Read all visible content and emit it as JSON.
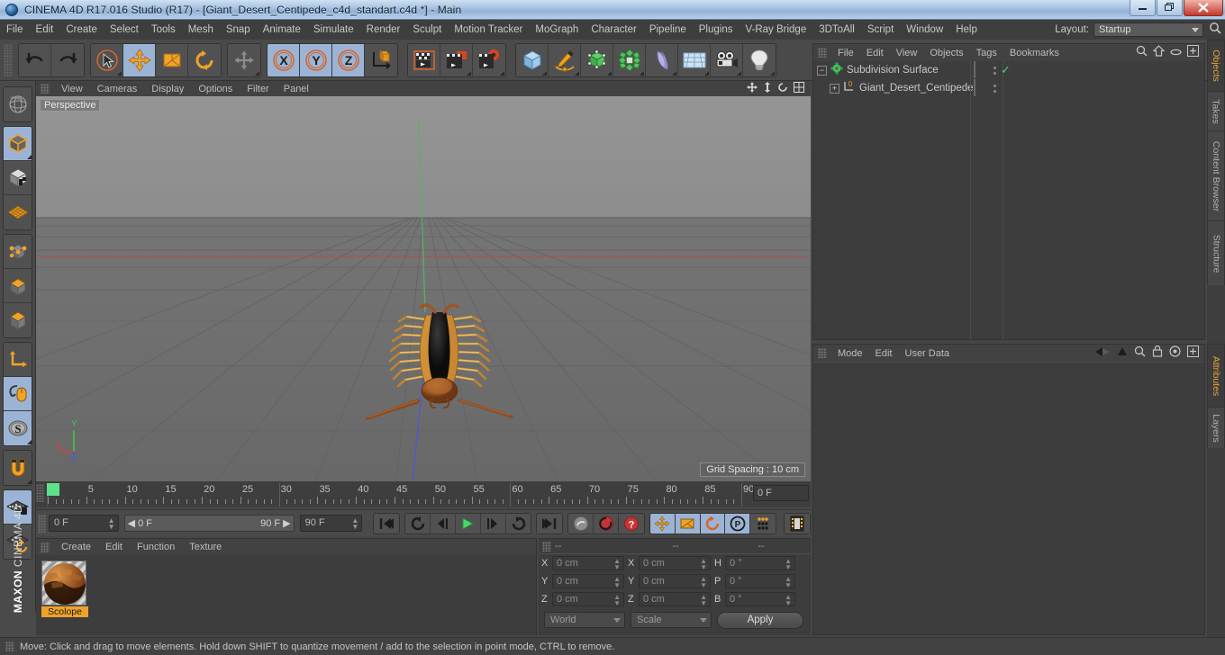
{
  "window": {
    "title": "CINEMA 4D R17.016 Studio (R17) - [Giant_Desert_Centipede_c4d_standart.c4d *] - Main",
    "minimize": "—",
    "restore": "❐",
    "close": "✕"
  },
  "menubar": {
    "items": [
      "File",
      "Edit",
      "Create",
      "Select",
      "Tools",
      "Mesh",
      "Snap",
      "Animate",
      "Simulate",
      "Render",
      "Sculpt",
      "Motion Tracker",
      "MoGraph",
      "Character",
      "Pipeline",
      "Plugins",
      "V-Ray Bridge",
      "3DToAll",
      "Script",
      "Window",
      "Help"
    ],
    "layout_label": "Layout:",
    "layout_value": "Startup"
  },
  "toolbar": {
    "groups": [
      {
        "name": "undo-redo",
        "buttons": [
          {
            "name": "undo-button",
            "icon": "undo"
          },
          {
            "name": "redo-button",
            "icon": "redo"
          }
        ]
      },
      {
        "name": "transform-tools",
        "buttons": [
          {
            "name": "select-tool",
            "icon": "cursor-circle",
            "selected": false,
            "corner": true
          },
          {
            "name": "move-tool",
            "icon": "move-arrows",
            "selected": true
          },
          {
            "name": "scale-tool",
            "icon": "scale-box",
            "selected": false
          },
          {
            "name": "rotate-tool",
            "icon": "rotate-arc",
            "selected": false
          }
        ]
      },
      {
        "name": "magnet-group",
        "buttons": [
          {
            "name": "magnet-tool",
            "icon": "move-arrows",
            "selected": false,
            "corner": true
          }
        ]
      },
      {
        "name": "axis-locks",
        "buttons": [
          {
            "name": "lock-x-axis",
            "icon": "x-axis",
            "selected": true
          },
          {
            "name": "lock-y-axis",
            "icon": "y-axis",
            "selected": true
          },
          {
            "name": "lock-z-axis",
            "icon": "z-axis",
            "selected": true
          },
          {
            "name": "world-coordinate-system",
            "icon": "world-axis",
            "selected": false
          }
        ]
      },
      {
        "name": "render-group",
        "buttons": [
          {
            "name": "render-view-button",
            "icon": "clapper",
            "selected": false
          },
          {
            "name": "render-region-button",
            "icon": "clapper-region",
            "corner": true
          },
          {
            "name": "render-settings-button",
            "icon": "clapper-gear",
            "corner": true
          }
        ]
      },
      {
        "name": "create-group",
        "buttons": [
          {
            "name": "add-cube-button",
            "icon": "cube-blue",
            "corner": true
          },
          {
            "name": "add-spline-button",
            "icon": "pen-spline",
            "corner": true
          },
          {
            "name": "add-generator-button",
            "icon": "green-cube",
            "corner": true
          },
          {
            "name": "add-array-button",
            "icon": "green-cluster",
            "corner": true
          },
          {
            "name": "add-deformer-button",
            "icon": "bend-shape",
            "corner": true
          },
          {
            "name": "add-scene-button",
            "icon": "floor-grid",
            "corner": true
          },
          {
            "name": "add-camera-button",
            "icon": "camera",
            "corner": true
          },
          {
            "name": "add-light-button",
            "icon": "lightbulb",
            "corner": true
          }
        ]
      }
    ]
  },
  "left_toolbar": {
    "buttons": [
      {
        "name": "make-editable-button",
        "icon": "globe-wire",
        "selected": false
      },
      {
        "name": "model-mode-button",
        "icon": "cube-orange-outline",
        "selected": true,
        "corner": true
      },
      {
        "name": "texture-mode-button",
        "icon": "checker-cube",
        "selected": false
      },
      {
        "name": "uv-mode-button",
        "icon": "orange-mesh-plane",
        "selected": false
      },
      {
        "name": "points-mode-button",
        "icon": "cube-points",
        "selected": false
      },
      {
        "name": "edges-mode-button",
        "icon": "cube-edges",
        "selected": false
      },
      {
        "name": "polygons-mode-button",
        "icon": "cube-polygons",
        "selected": false
      },
      {
        "name": "object-axis-button",
        "icon": "axis-L",
        "selected": false
      },
      {
        "name": "viewport-solo-button",
        "icon": "mouse-orange",
        "selected": true
      },
      {
        "name": "enable-snap-button",
        "icon": "s-circle",
        "selected": true,
        "corner": true
      },
      {
        "name": "magnet-button",
        "icon": "magnet",
        "selected": false,
        "corner": true
      },
      {
        "name": "lock-workplane-button",
        "icon": "grid-lock",
        "selected": true
      },
      {
        "name": "workplane-rotate-button",
        "icon": "grid-rotate",
        "selected": false
      }
    ],
    "brand": "CINEMA 4D",
    "brand_bold": "MAXON"
  },
  "viewport": {
    "menu": [
      "View",
      "Cameras",
      "Display",
      "Options",
      "Filter",
      "Panel"
    ],
    "label": "Perspective",
    "grid_spacing": "Grid Spacing : 10 cm",
    "axis": {
      "x": "X",
      "y": "Y",
      "z": "Z",
      "x_color": "#d64141",
      "y_color": "#44c24a",
      "z_color": "#4a5ad8"
    },
    "scene_axis": {
      "vertical_color": "#55c45a",
      "horizontal_color": "#cf4040",
      "depth_color": "#4f5fd0"
    }
  },
  "timeline": {
    "ticks": [
      0,
      5,
      10,
      15,
      20,
      25,
      30,
      35,
      40,
      45,
      50,
      55,
      60,
      65,
      70,
      75,
      80,
      85,
      90
    ],
    "min": 0,
    "max": 90,
    "current_frame_field": "0 F"
  },
  "transport": {
    "current_frame": "0 F",
    "range_start": "0 F",
    "range_end": "90 F",
    "end_frame": "90 F",
    "buttons": [
      {
        "name": "go-to-start-button",
        "icon": "skip-start"
      },
      {
        "name": "play-reverse-loop-button",
        "icon": "loop-back"
      },
      {
        "name": "step-back-button",
        "icon": "prev-frame"
      },
      {
        "name": "play-button",
        "icon": "play",
        "accent": "#49d96b"
      },
      {
        "name": "step-forward-button",
        "icon": "next-frame"
      },
      {
        "name": "play-forward-loop-button",
        "icon": "loop-forward"
      },
      {
        "name": "go-to-end-button",
        "icon": "skip-end"
      },
      {
        "name": "record-active-objects-button",
        "icon": "key-gray"
      },
      {
        "name": "autokeying-button",
        "icon": "record-circle",
        "accent": "#d03a3a"
      },
      {
        "name": "keyframe-selection-button",
        "icon": "question-circle",
        "accent": "#d03a3a"
      },
      {
        "name": "position-key-button",
        "icon": "move-arrows",
        "selected": true
      },
      {
        "name": "scale-key-button",
        "icon": "scale-box",
        "selected": true
      },
      {
        "name": "rotation-key-button",
        "icon": "rotate-arc",
        "selected": true
      },
      {
        "name": "parameter-key-button",
        "icon": "p-circle",
        "selected": true
      },
      {
        "name": "point-level-animation-button",
        "icon": "dot-matrix"
      },
      {
        "name": "timeline-filmstrip-button",
        "icon": "filmstrip"
      }
    ]
  },
  "material_manager": {
    "menu": [
      "Create",
      "Edit",
      "Function",
      "Texture"
    ],
    "materials": [
      {
        "name": "Scolope"
      }
    ]
  },
  "coordinates": {
    "headers": [
      "--",
      "--",
      "--"
    ],
    "rows": [
      {
        "label_pos": "X",
        "value_pos": "0 cm",
        "label_size": "X",
        "value_size": "0 cm",
        "label_rot": "H",
        "value_rot": "0 °"
      },
      {
        "label_pos": "Y",
        "value_pos": "0 cm",
        "label_size": "Y",
        "value_size": "0 cm",
        "label_rot": "P",
        "value_rot": "0 °"
      },
      {
        "label_pos": "Z",
        "value_pos": "0 cm",
        "label_size": "Z",
        "value_size": "0 cm",
        "label_rot": "B",
        "value_rot": "0 °"
      }
    ],
    "system": "World",
    "mode": "Scale",
    "apply": "Apply"
  },
  "object_manager": {
    "menu": [
      "File",
      "Edit",
      "View",
      "Objects",
      "Tags",
      "Bookmarks"
    ],
    "icons": [
      "search-icon",
      "home-icon",
      "ellipse-icon",
      "plus-box-icon"
    ],
    "items": [
      {
        "name": "Subdivision Surface",
        "depth": 0,
        "icon": "subdivision-surface-icon",
        "checked": true
      },
      {
        "name": "Giant_Desert_Centipede",
        "depth": 1,
        "icon": "null-object-icon",
        "checked": false
      }
    ]
  },
  "attributes": {
    "menu": [
      "Mode",
      "Edit",
      "User Data"
    ],
    "icons": [
      "back-arrow-icon",
      "up-arrow-icon",
      "search-icon",
      "lock-icon",
      "target-icon",
      "plus-box-icon"
    ]
  },
  "edge_tabs": [
    {
      "label": "Objects",
      "active": true
    },
    {
      "label": "Takes",
      "active": false
    },
    {
      "label": "Content Browser",
      "active": false
    },
    {
      "label": "Structure",
      "active": false
    },
    {
      "label": "Attributes",
      "active": true
    },
    {
      "label": "Layers",
      "active": false
    }
  ],
  "status_bar": {
    "text": "Move: Click and drag to move elements. Hold down SHIFT to quantize movement / add to the selection in point mode, CTRL to remove."
  }
}
